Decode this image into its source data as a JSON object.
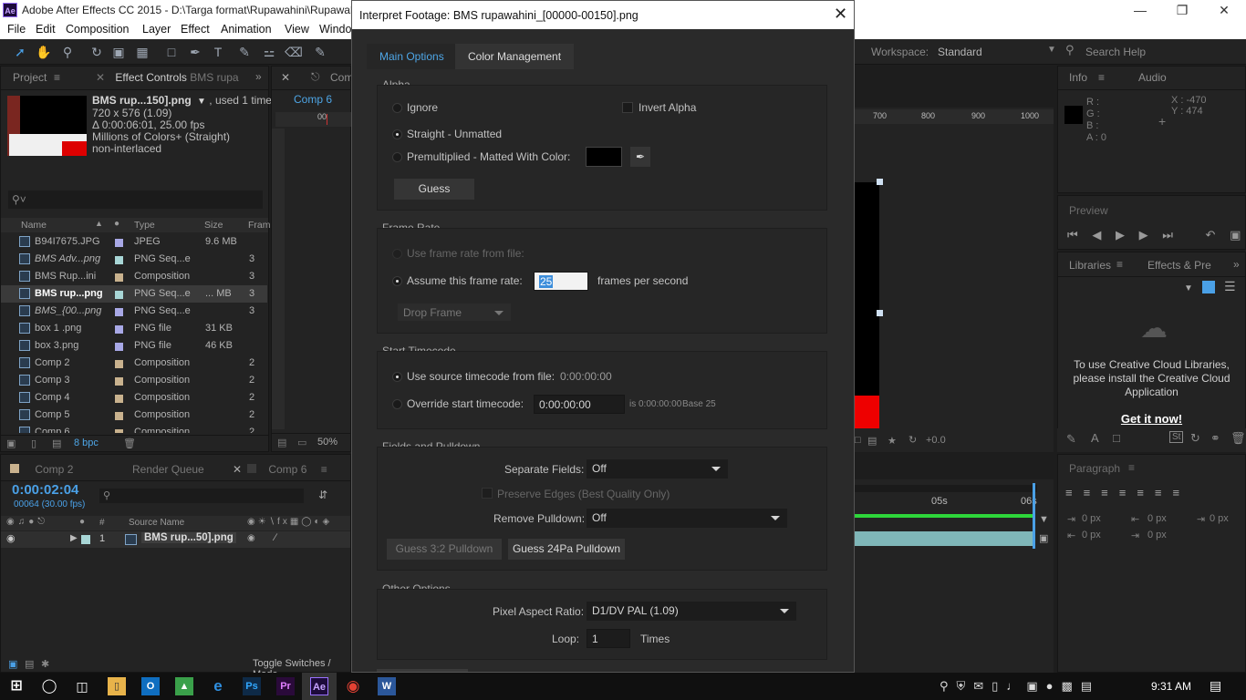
{
  "window": {
    "title": "Adobe After Effects CC 2015 - D:\\Targa format\\Rupawahini\\Rupawah",
    "app_icon": "Ae"
  },
  "menu": [
    "File",
    "Edit",
    "Composition",
    "Layer",
    "Effect",
    "Animation",
    "View",
    "Windo"
  ],
  "workspace": {
    "label": "Workspace:",
    "value": "Standard",
    "search_placeholder": "Search Help"
  },
  "project": {
    "tabs": {
      "project": "Project",
      "effect_controls": "Effect Controls",
      "effect_controls_sub": "BMS rupa"
    },
    "preview_info": {
      "name": "BMS rup...150].png",
      "used": ", used 1 time",
      "dims": "720 x 576 (1.09)",
      "duration": "Δ 0:00:06:01, 25.00 fps",
      "colors": "Millions of Colors+ (Straight)",
      "interlace": "non-interlaced"
    },
    "search_placeholder": "",
    "columns": {
      "name": "Name",
      "type": "Type",
      "size": "Size",
      "frame": "Fram"
    },
    "rows": [
      {
        "name": "B94I7675.JPG",
        "type": "JPEG",
        "size": "9.6 MB",
        "frame": "",
        "swatch": "#a8a8e6"
      },
      {
        "name": "BMS Adv...png",
        "type": "PNG Seq...e",
        "size": "",
        "frame": "3",
        "swatch": "#a8d6d6"
      },
      {
        "name": "BMS Rup...ini",
        "type": "Composition",
        "size": "",
        "frame": "3",
        "swatch": "#c9b28e"
      },
      {
        "name": "BMS rup...png",
        "type": "PNG Seq...e",
        "size": "... MB",
        "frame": "3",
        "swatch": "#a8d6d6"
      },
      {
        "name": "BMS_{00...png",
        "type": "PNG Seq...e",
        "size": "",
        "frame": "3",
        "swatch": "#a8a8e6"
      },
      {
        "name": "box 1 .png",
        "type": "PNG file",
        "size": "31 KB",
        "frame": "",
        "swatch": "#a8a8e6"
      },
      {
        "name": "box 3.png",
        "type": "PNG file",
        "size": "46 KB",
        "frame": "",
        "swatch": "#a8a8e6"
      },
      {
        "name": "Comp 2",
        "type": "Composition",
        "size": "",
        "frame": "2",
        "swatch": "#c9b28e"
      },
      {
        "name": "Comp 3",
        "type": "Composition",
        "size": "",
        "frame": "2",
        "swatch": "#c9b28e"
      },
      {
        "name": "Comp 4",
        "type": "Composition",
        "size": "",
        "frame": "2",
        "swatch": "#c9b28e"
      },
      {
        "name": "Comp 5",
        "type": "Composition",
        "size": "",
        "frame": "2",
        "swatch": "#c9b28e"
      },
      {
        "name": "Comp 6",
        "type": "Composition",
        "size": "",
        "frame": "2",
        "swatch": "#c9b28e"
      }
    ],
    "bpc": "8 bpc"
  },
  "comp": {
    "tab": "Com",
    "inner_tab": "Comp 6",
    "ruler_marks": [
      "00",
      "700",
      "800",
      "900",
      "1000"
    ],
    "zoom": "50%",
    "exposure": "+0.0"
  },
  "timeline": {
    "tabs": [
      "Comp 2",
      "Render Queue",
      "Comp 6"
    ],
    "timecode": "0:00:02:04",
    "frames": "00064 (30.00 fps)",
    "col_num": "#",
    "col_source": "Source Name",
    "layer": {
      "num": "1",
      "name": "BMS rup...50].png"
    },
    "toggle_label": "Toggle Switches / Mode",
    "time_marks": [
      "05s",
      "06s"
    ]
  },
  "info": {
    "tabs": [
      "Info",
      "Audio"
    ],
    "r": "R :",
    "g": "G :",
    "b": "B :",
    "a": "A : 0",
    "x": "X : -470",
    "y": "Y : 474"
  },
  "preview": {
    "tab": "Preview"
  },
  "libraries": {
    "tabs": [
      "Libraries",
      "Effects & Pre"
    ],
    "message": "To use Creative Cloud Libraries, please install the Creative Cloud Application",
    "link": "Get it now!"
  },
  "paragraph": {
    "tab": "Paragraph",
    "px": [
      "0 px",
      "0 px",
      "0 px",
      "0 px",
      "0 px"
    ]
  },
  "dialog": {
    "title": "Interpret Footage: BMS rupawahini_[00000-00150].png",
    "tabs": [
      "Main Options",
      "Color Management"
    ],
    "alpha": {
      "label": "Alpha",
      "ignore": "Ignore",
      "invert": "Invert Alpha",
      "straight": "Straight - Unmatted",
      "premultiplied": "Premultiplied - Matted With Color:",
      "guess": "Guess"
    },
    "frame_rate": {
      "label": "Frame Rate",
      "use_file": "Use frame rate from file:",
      "assume": "Assume this frame rate:",
      "value": "25",
      "unit": "frames per second",
      "drop_frame": "Drop Frame"
    },
    "start_timecode": {
      "label": "Start Timecode",
      "use_source": "Use source timecode from file:",
      "source_value": "0:00:00:00",
      "override": "Override start timecode:",
      "override_value": "0:00:00:00",
      "is_text": "is 0:00:00:00",
      "base": "Base 25"
    },
    "fields": {
      "label": "Fields and Pulldown",
      "separate_label": "Separate Fields:",
      "separate_value": "Off",
      "preserve": "Preserve Edges (Best Quality Only)",
      "remove_label": "Remove Pulldown:",
      "remove_value": "Off",
      "guess32": "Guess 3:2 Pulldown",
      "guess24": "Guess 24Pa Pulldown"
    },
    "other": {
      "label": "Other Options",
      "par_label": "Pixel Aspect Ratio:",
      "par_value": "D1/DV PAL (1.09)",
      "loop_label": "Loop:",
      "loop_value": "1",
      "times": "Times"
    }
  },
  "taskbar": {
    "time": "9:31 AM"
  }
}
